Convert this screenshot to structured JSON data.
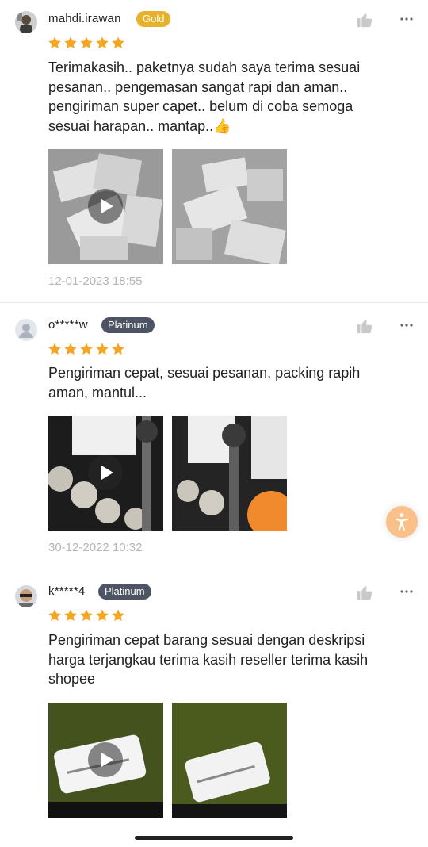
{
  "reviews": [
    {
      "username": "mahdi.irawan",
      "badge": "Gold",
      "rating": 5,
      "text": "Terimakasih.. paketnya sudah saya terima sesuai pesanan.. pengemasan sangat rapi dan aman.. pengiriman super capet.. belum di coba semoga sesuai harapan.. mantap..👍",
      "timestamp": "12-01-2023 18:55",
      "media": [
        "video-thumbnail",
        "photo-thumbnail"
      ]
    },
    {
      "username": "o*****w",
      "badge": "Platinum",
      "rating": 5,
      "text": "Pengiriman cepat, sesuai pesanan, packing rapih aman, mantul...",
      "timestamp": "30-12-2022 10:32",
      "media": [
        "video-thumbnail",
        "photo-thumbnail"
      ]
    },
    {
      "username": "k*****4",
      "badge": "Platinum",
      "rating": 5,
      "text": "Pengiriman cepat barang sesuai dengan deskripsi harga terjangkau terima kasih reseller terima kasih shopee",
      "media": [
        "video-thumbnail",
        "photo-thumbnail"
      ]
    }
  ],
  "icons": {
    "like": "thumbs-up-icon",
    "more": "more-options-icon",
    "star": "star-icon",
    "play": "play-icon",
    "floating": "accessibility-icon"
  },
  "colors": {
    "star": "#f5a623",
    "gold_badge": "#e8b12c",
    "platinum_badge": "#4d5463",
    "timestamp": "#b5b5b5",
    "floating_button": "#f9c189"
  }
}
